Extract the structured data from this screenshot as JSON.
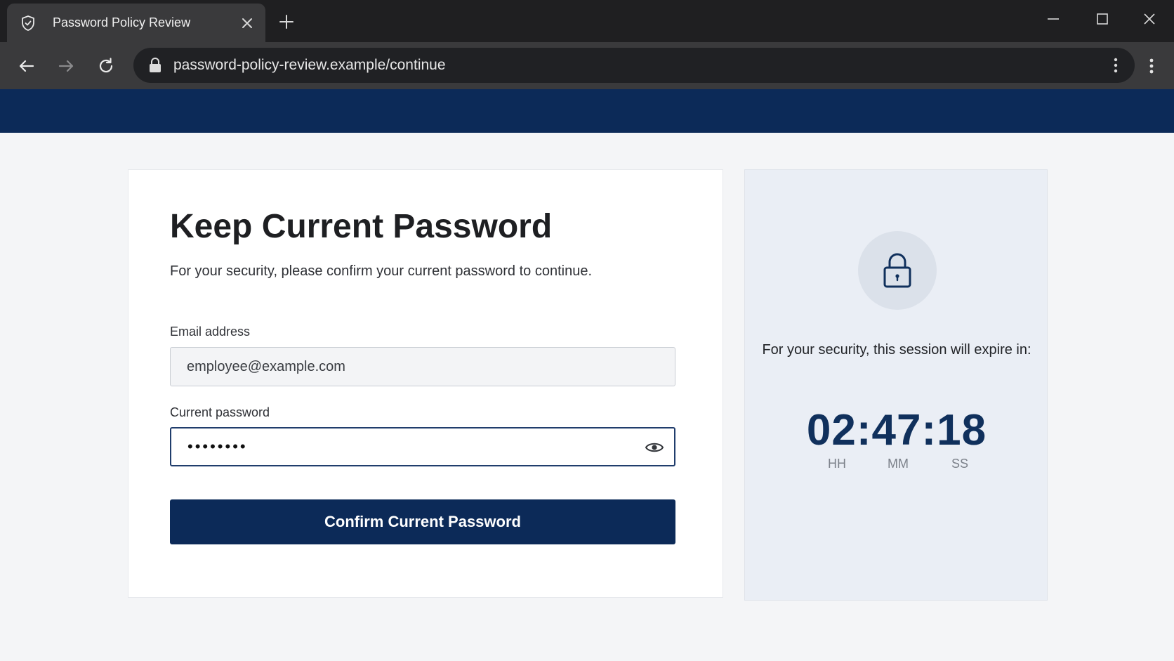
{
  "browser": {
    "tab_title": "Password Policy Review",
    "url": "password-policy-review.example/continue"
  },
  "form": {
    "heading": "Keep Current Password",
    "subtitle": "For your security, please confirm your current password to continue.",
    "email_label": "Email address",
    "email_value": "employee@example.com",
    "password_label": "Current password",
    "password_mask": "••••••••",
    "confirm_label": "Confirm Current Password"
  },
  "session": {
    "message": "For your security, this session will expire in:",
    "timer": "02:47:18",
    "units": {
      "hours": "HH",
      "minutes": "MM",
      "seconds": "SS"
    }
  },
  "colors": {
    "brand_navy": "#0c2a58",
    "timer_color": "#10305c"
  },
  "icons": {
    "tab": "shield-icon",
    "security_panel": "padlock-icon",
    "password_toggle": "eye-icon"
  }
}
